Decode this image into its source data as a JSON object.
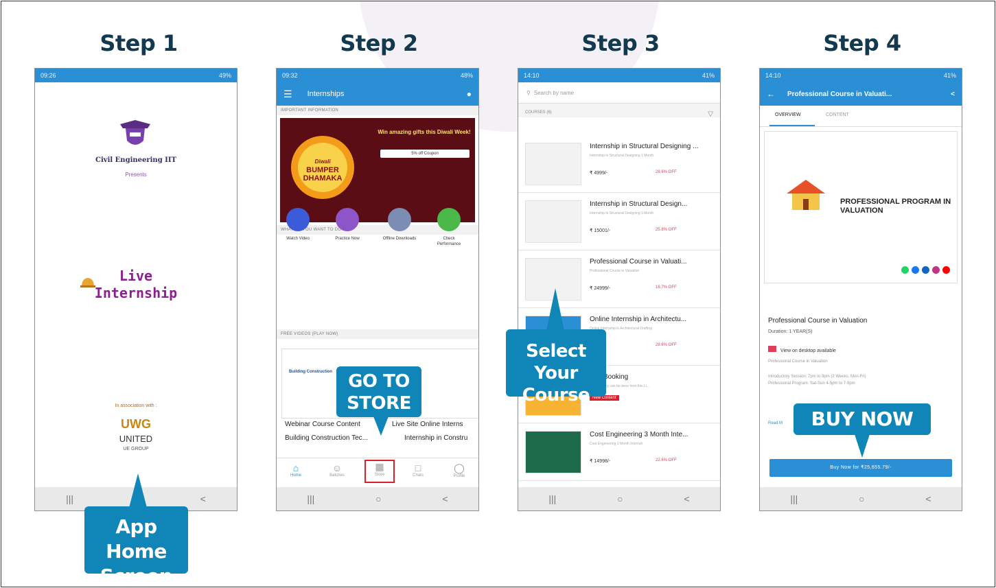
{
  "steps": [
    {
      "title": "Step 1"
    },
    {
      "title": "Step 2"
    },
    {
      "title": "Step 3"
    },
    {
      "title": "Step 4"
    }
  ],
  "callouts": {
    "home": [
      "App Home",
      "Screen"
    ],
    "store": [
      "GO TO",
      "STORE"
    ],
    "select": [
      "Select Your",
      "Course"
    ],
    "buy": "BUY NOW"
  },
  "phone1": {
    "status_time": "09:26",
    "status_right": "49%",
    "brand": "Civil Engineering IIT",
    "presents": "Presents",
    "live_line1": "Live",
    "live_line2": "Internship",
    "assoc": "In association with :",
    "uwg": "UWG",
    "united": "UNITED",
    "group": "UE GROUP"
  },
  "phone2": {
    "status_time": "09:32",
    "status_right": "48%",
    "appbar_title": "Internships",
    "sec_important": "IMPORTANT INFORMATION",
    "banner_win": "Win amazing gifts this Diwali Week!",
    "banner_coupon": "5% off Coupon",
    "banner_bumper": [
      "Diwali",
      "BUMPER",
      "DHAMAKA"
    ],
    "sec_what": "WHAT DO YOU WANT TO DO?",
    "actions": [
      {
        "label": "Watch Video",
        "color": "#3b5bd9"
      },
      {
        "label": "Practice Now",
        "color": "#8e55c9"
      },
      {
        "label": "Offline Downloads",
        "color": "#7b8db3"
      },
      {
        "label": "Check Performance",
        "color": "#4bb84a"
      }
    ],
    "sec_free": "FREE VIDEOS (PLAY NOW)",
    "card_heading": "Building Construction",
    "card_line1": "Webinar Course Content",
    "card_line2": "Live Site Online Interns",
    "card_line3": "Building Construction Tec...",
    "card_line4": "Internship in Constru",
    "nav": [
      "Home",
      "Batches",
      "Store",
      "Chats",
      "Profile"
    ]
  },
  "phone3": {
    "status_time": "14:10",
    "status_right": "41%",
    "search_placeholder": "Search by name",
    "section": "COURSES (6)",
    "courses": [
      {
        "title": "Internship in Structural Designing ...",
        "sub": "Internship in Structural Designing 1 Month",
        "price": "₹ 4999/-",
        "off": "28.6% OFF"
      },
      {
        "title": "Internship in Structural Design...",
        "sub": "Internship in Structural Designing 3 Month",
        "price": "₹ 15001/-",
        "off": "25.8% OFF"
      },
      {
        "title": "Professional Course in Valuati...",
        "sub": "Professional Course in Valuation",
        "price": "₹ 24999/-",
        "off": "16.7% OFF"
      },
      {
        "title": "Online Internship in Architectu...",
        "sub": "Online Internship in Architectural Drafting",
        "price": "",
        "off": "28.6% OFF"
      },
      {
        "title": "Site Booking",
        "sub": "Site Booking can be done from this Li...",
        "price": "",
        "off": "New Content"
      },
      {
        "title": "Cost Engineering 3 Month Inte...",
        "sub": "Cost Engineering 3 Month Internsh",
        "price": "₹ 14998/-",
        "off": "22.6% OFF"
      }
    ]
  },
  "phone4": {
    "status_time": "14:10",
    "status_right": "41%",
    "appbar_title": "Professional Course in Valuati...",
    "tab_overview": "OVERVIEW",
    "tab_content": "CONTENT",
    "hero_title": "PROFESSIONAL PROGRAM IN VALUATION",
    "course_name": "Professional Course in Valuation",
    "duration": "Duration: 1 YEAR(S)",
    "desktop": "View on desktop available",
    "desc1": "Professional Course in Valuation",
    "desc2": "Introductory Session: 7pm to 9pm (2 Weeks, Mon-Fri)",
    "desc3": "Professional Program: Sat-Sun 4-5pm to 7-9pm",
    "read_more": "Read M",
    "buy_button": "Buy Now for ₹25,655.79/-"
  }
}
